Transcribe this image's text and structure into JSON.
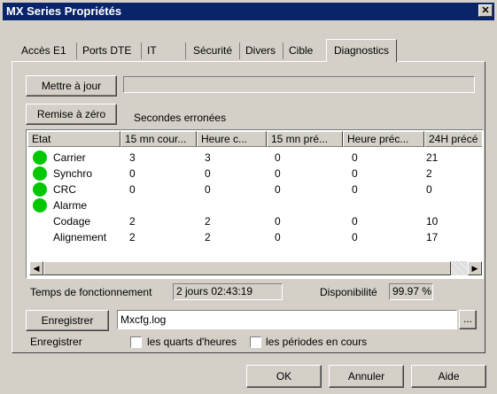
{
  "window": {
    "title": "MX Series Propriétés"
  },
  "tabs": [
    {
      "label": "Accès E1"
    },
    {
      "label": "Ports DTE"
    },
    {
      "label": "IT"
    },
    {
      "label": "Sécurité"
    },
    {
      "label": "Divers"
    },
    {
      "label": "Cible"
    },
    {
      "label": "Diagnostics",
      "active": true
    }
  ],
  "buttons": {
    "update": "Mettre à jour",
    "reset": "Remise à zéro",
    "save": "Enregistrer",
    "browse": "...",
    "ok": "OK",
    "cancel": "Annuler",
    "help": "Aide"
  },
  "errored_seconds_label": "Secondes erronées",
  "table": {
    "columns": [
      "Etat",
      "15 mn cour...",
      "Heure c...",
      "15 mn pré...",
      "Heure préc...",
      "24H précé"
    ],
    "rows": [
      {
        "led": "green",
        "cells": [
          "Carrier",
          "3",
          "3",
          "0",
          "0",
          "21"
        ]
      },
      {
        "led": "green",
        "cells": [
          "Synchro",
          "0",
          "0",
          "0",
          "0",
          "2"
        ]
      },
      {
        "led": "green",
        "cells": [
          "CRC",
          "0",
          "0",
          "0",
          "0",
          "0"
        ]
      },
      {
        "led": "green",
        "cells": [
          "Alarme",
          "",
          "",
          "",
          "",
          ""
        ]
      },
      {
        "led": "",
        "cells": [
          "Codage",
          "2",
          "2",
          "0",
          "0",
          "10"
        ]
      },
      {
        "led": "",
        "cells": [
          "Alignement",
          "2",
          "2",
          "0",
          "0",
          "17"
        ]
      }
    ]
  },
  "status": {
    "uptime_label": "Temps de fonctionnement",
    "uptime_value": "2 jours 02:43:19",
    "availability_label": "Disponibilité",
    "availability_value": "99.97 %"
  },
  "save": {
    "file_value": "Mxcfg.log",
    "save_label": "Enregistrer",
    "quarter_hours_label": "les quarts d'heures",
    "current_periods_label": "les périodes en cours"
  },
  "colors": {
    "titlebar": "#0a246a",
    "dialog": "#d4d0c8",
    "led_green": "#00c800"
  }
}
